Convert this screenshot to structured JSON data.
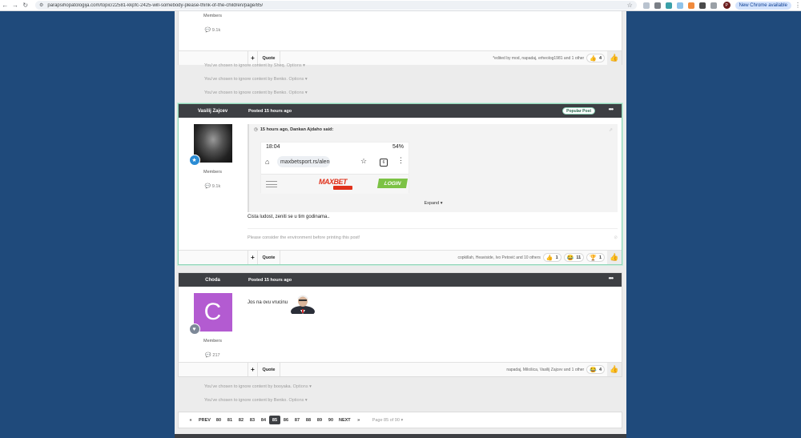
{
  "browser": {
    "url": "parapsihopatologija.com/topic/22581-kkpfc-2425-will-somebody-please-think-of-the-children/page/85/",
    "update_label": "New Chrome available",
    "profile_initial": "P",
    "nav": {
      "back": "←",
      "forward": "→",
      "reload": "↻"
    }
  },
  "top_partial": {
    "group": "Members",
    "post_count": "9.1k",
    "edited_by": "*edited by mod, napadaj, erheolog1981 and 1 other",
    "reaction_count": "4",
    "multiquote": "+",
    "quote_label": "Quote"
  },
  "ignored_1": [
    {
      "text": "You've chosen to ignore content by Sheq.",
      "options": "Options"
    },
    {
      "text": "You've chosen to ignore content by Benko.",
      "options": "Options"
    },
    {
      "text": "You've chosen to ignore content by Benko.",
      "options": "Options"
    }
  ],
  "post_zajcev": {
    "author": "Vasilij Zajcev",
    "posted": "Posted 15 hours ago",
    "popular": "Popular Post",
    "menu": "•••",
    "group": "Members",
    "post_count": "9.1k",
    "quote_cite": "15 hours ago, Dankan Ajdaho said:",
    "screenshot": {
      "time": "18:04",
      "status_right": "54%",
      "url": "maxbetsport.rs/alen-",
      "logo": "MAXBET",
      "login": "LOGIN"
    },
    "expand": "Expand",
    "body": "Cista ludost, zeniti se u tim godinama..",
    "signature": "Please consider the environment before printing this post!",
    "multiquote": "+",
    "quote_label": "Quote",
    "reactors": "copkillah, Heaviside, Ivo Petović and 10 others",
    "reactions": [
      {
        "emoji": "👍",
        "count": "1"
      },
      {
        "emoji": "😂",
        "count": "11"
      },
      {
        "emoji": "🏆",
        "count": "1"
      }
    ]
  },
  "post_choda": {
    "author": "Choda",
    "posted": "Posted 15 hours ago",
    "menu": "•••",
    "avatar_letter": "C",
    "group": "Members",
    "post_count": "217",
    "body": "Jos na ovu vrucinu",
    "multiquote": "+",
    "quote_label": "Quote",
    "reactors": "napadaj, Milošica, Vasilij Zajcev and 1 other",
    "reactions": [
      {
        "emoji": "😂",
        "count": "4"
      }
    ]
  },
  "ignored_2": [
    {
      "text": "You've chosen to ignore content by booyaka.",
      "options": "Options"
    },
    {
      "text": "You've chosen to ignore content by Benko.",
      "options": "Options"
    }
  ],
  "pagination": {
    "first": "«",
    "prev": "PREV",
    "pages": [
      "80",
      "81",
      "82",
      "83",
      "84",
      "85",
      "86",
      "87",
      "88",
      "89",
      "90"
    ],
    "current": "85",
    "next": "NEXT",
    "last": "»",
    "jump": "Page 85 of 90"
  },
  "colors": {
    "page_bg": "#1f4a7b",
    "header_bg": "#3d3f43",
    "highlight_border": "#8fd4b8",
    "avatar_c": "#b35bd1"
  }
}
